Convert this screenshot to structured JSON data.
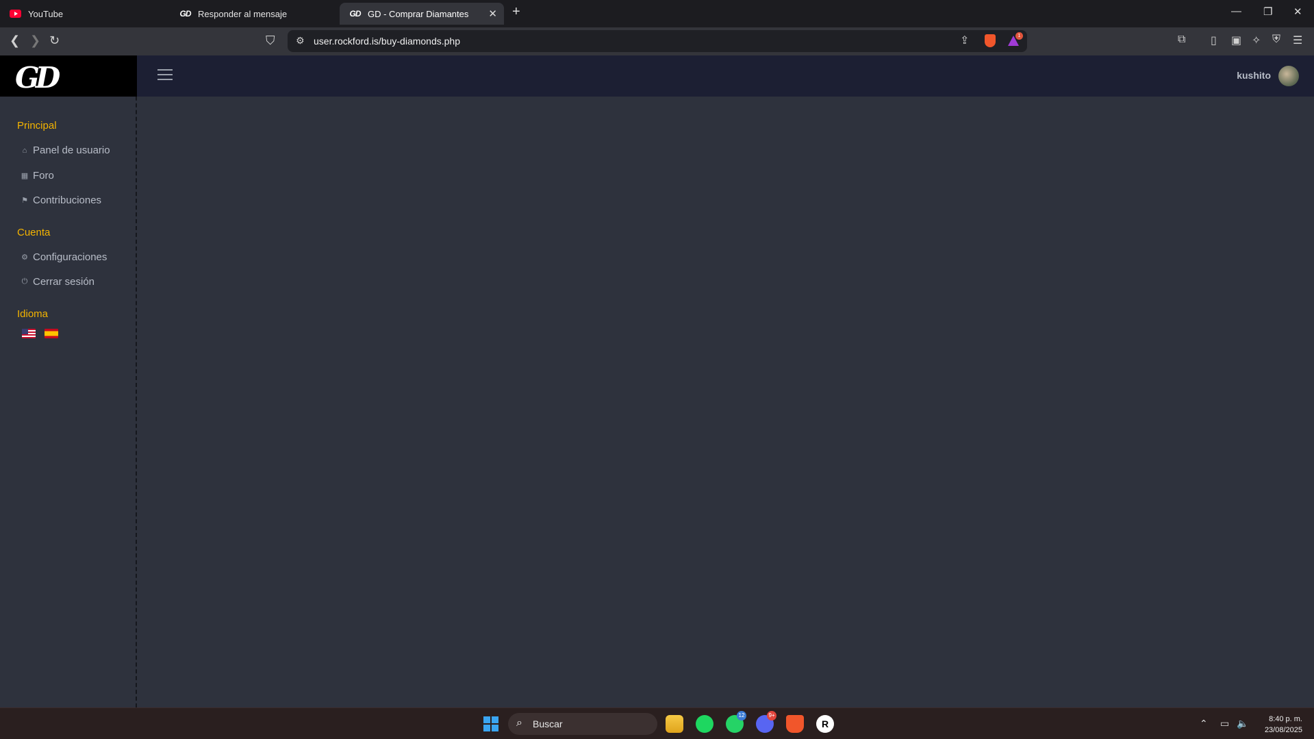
{
  "browser": {
    "tabs": [
      {
        "label": "YouTube",
        "icon": "youtube-icon"
      },
      {
        "label": "Responder al mensaje",
        "icon": "gd-icon"
      },
      {
        "label": "GD - Comprar Diamantes",
        "icon": "gd-icon",
        "active": true
      }
    ],
    "url": "user.rockford.is/buy-diamonds.php",
    "rewards_badge": "1"
  },
  "sidebar": {
    "logo": "GD",
    "sections": [
      {
        "title": "Principal",
        "items": [
          {
            "label": "Panel de usuario",
            "icon": "home-icon"
          },
          {
            "label": "Foro",
            "icon": "table-icon"
          },
          {
            "label": "Contribuciones",
            "icon": "contributions-icon"
          }
        ]
      },
      {
        "title": "Cuenta",
        "items": [
          {
            "label": "Configuraciones",
            "icon": "gear-icon"
          },
          {
            "label": "Cerrar sesión",
            "icon": "power-icon"
          }
        ]
      },
      {
        "title": "Idioma",
        "flags": [
          "us-flag",
          "es-flag"
        ]
      }
    ]
  },
  "topnav": {
    "username": "kushito"
  },
  "taskbar": {
    "search_label": "Buscar",
    "whatsapp_badge": "12",
    "discord_badge": "9+",
    "time": "8:40 p. m.",
    "date": "23/08/2025"
  }
}
